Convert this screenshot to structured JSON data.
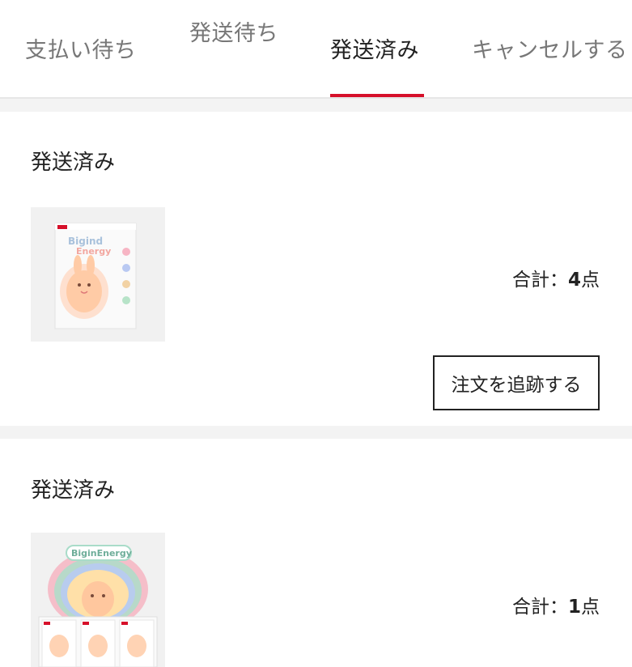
{
  "tabs": [
    {
      "label": "支払い待ち",
      "active": false
    },
    {
      "label": "発送待ち",
      "active": false
    },
    {
      "label": "発送済み",
      "active": true
    },
    {
      "label": "キャンセルする",
      "active": false
    }
  ],
  "orders": [
    {
      "status": "発送済み",
      "total_prefix": "合計：",
      "total_count": "4",
      "total_unit": "点",
      "track_label": "注文を追跡する",
      "product_image": "box-with-bunny-figure-image"
    },
    {
      "status": "発送済み",
      "total_prefix": "合計：",
      "total_count": "1",
      "total_unit": "点",
      "product_image": "boxed-set-with-bunny-figure-image"
    }
  ],
  "colors": {
    "accent": "#d6102a",
    "tab_inactive": "#777777",
    "text": "#222222",
    "separator": "#f3f3f3"
  }
}
